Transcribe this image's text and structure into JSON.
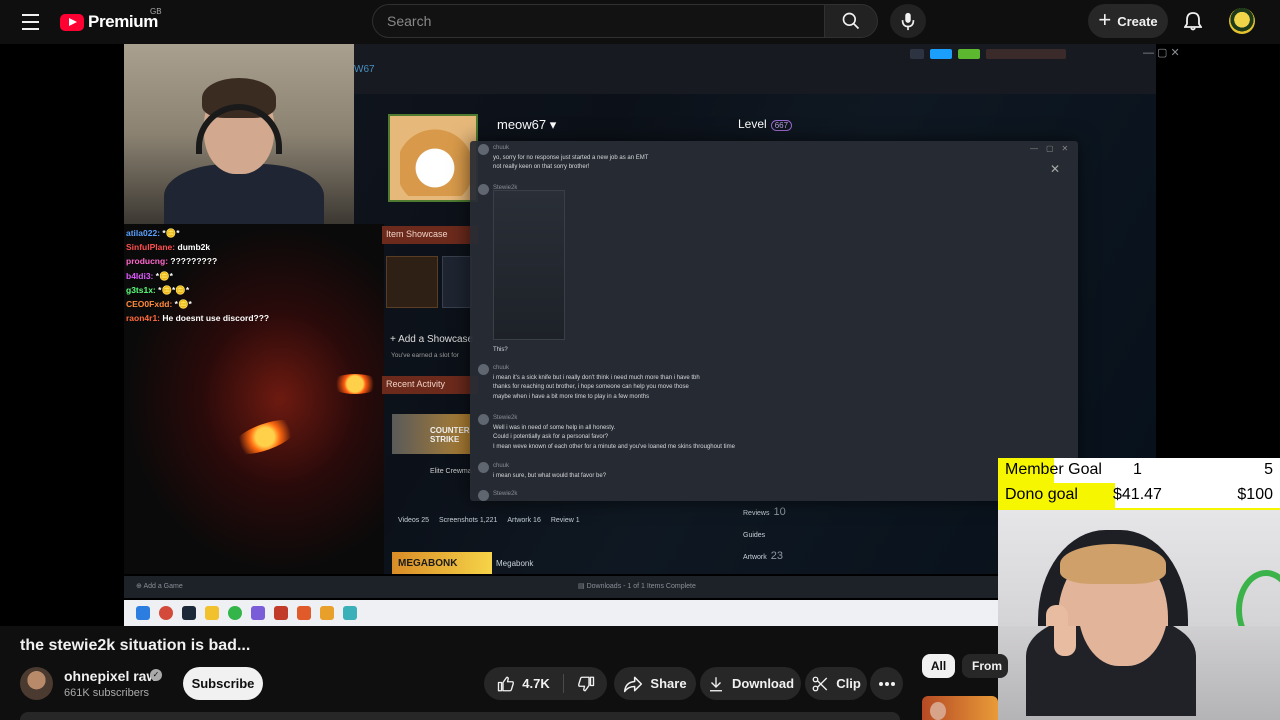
{
  "header": {
    "logo_text": "Premium",
    "region": "GB",
    "search_placeholder": "Search",
    "create_label": "Create",
    "icons": [
      "menu-icon",
      "search-icon",
      "mic-icon",
      "plus-icon",
      "bell-icon"
    ]
  },
  "video": {
    "steam_tab": "W67",
    "chat": [
      {
        "name": "atila022:",
        "msg": "*🪙*",
        "color": "#5aa0ff"
      },
      {
        "name": "SinfulPlane:",
        "msg": "dumb2k",
        "color": "#ff4d4d"
      },
      {
        "name": "producng:",
        "msg": "?????????",
        "color": "#ff66cc"
      },
      {
        "name": "b4ldi3:",
        "msg": "*🪙*",
        "color": "#e05aff"
      },
      {
        "name": "g3ts1x:",
        "msg": "*🪙*🪙*",
        "color": "#5aff7a"
      },
      {
        "name": "CEO0Fxdd:",
        "msg": "*🪙*",
        "color": "#ff8a3c"
      },
      {
        "name": "raon4r1:",
        "msg": "He doesnt use discord???",
        "color": "#ff6a3c"
      }
    ],
    "steam_profile": {
      "name": "meow67",
      "level_label": "Level",
      "level_value": "667",
      "item_showcase": "Item Showcase",
      "add_showcase": "+ Add a Showcase",
      "add_showcase_sub": "You've earned a slot for",
      "recent_activity": "Recent Activity",
      "cs_logo": "COUNTER STRIKE",
      "elite": "Elite Crewma",
      "stats": [
        "Videos 25",
        "Screenshots 1,221",
        "Artwork 16",
        "Review 1"
      ],
      "side_stats": [
        {
          "label": "Reviews",
          "value": "10"
        },
        {
          "label": "Guides",
          "value": ""
        },
        {
          "label": "Artwork",
          "value": "23"
        }
      ],
      "megabonk_logo": "MEGABONK",
      "megabonk_label": "Megabonk",
      "bottom_add_game": "Add a Game",
      "bottom_downloads": "Downloads - 1 of 1 Items Complete"
    },
    "dm_messages": [
      {
        "who": "chuuk",
        "text": "yo, sorry for no response just started a new job as an EMT\nnot really keen on that sorry brother!"
      },
      {
        "who": "Stewie2k",
        "text": ""
      },
      {
        "who": "",
        "text": "This?"
      },
      {
        "who": "chuuk",
        "text": "i mean it's a sick knife but i really don't think i need much more than i have tbh\nthanks for reaching out brother, i hope someone can help you move those\nmaybe when i have a bit more time to play in a few months"
      },
      {
        "who": "Stewie2k",
        "text": "Well i was in need of some help in all honesty.\nCould i potentially ask for a personal favor?\nI mean weve known of each other for a minute and you've loaned me skins throughout time"
      },
      {
        "who": "chuuk",
        "text": "i mean sure, but what would that favor be?"
      },
      {
        "who": "Stewie2k",
        "text": ""
      }
    ],
    "goals": {
      "member_label": "Member Goal",
      "member_current": "1",
      "member_target": "5",
      "dono_label": "Dono goal",
      "dono_current": "$41.47",
      "dono_target": "$100",
      "dono_fraction": 0.4147
    }
  },
  "watch": {
    "title": "the stewie2k situation is bad...",
    "channel_name": "ohnepixel raw",
    "subscribers": "661K subscribers",
    "subscribe_label": "Subscribe",
    "likes": "4.7K",
    "share_label": "Share",
    "download_label": "Download",
    "clip_label": "Clip",
    "chips": [
      "All",
      "From"
    ]
  }
}
